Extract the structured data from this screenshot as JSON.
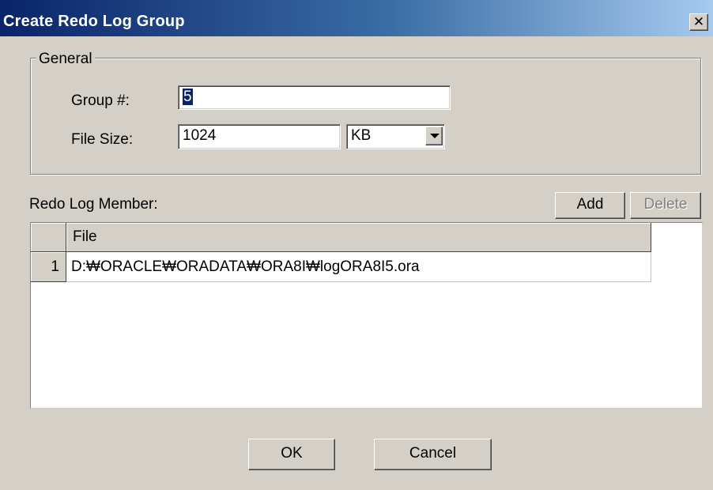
{
  "window": {
    "title": "Create Redo Log Group",
    "close_symbol": "✕"
  },
  "general": {
    "legend": "General",
    "group_label": "Group #:",
    "group_value": "5",
    "filesize_label": "File Size:",
    "filesize_value": "1024",
    "unit_selected": "KB"
  },
  "members": {
    "label": "Redo Log Member:",
    "add_label": "Add",
    "delete_label": "Delete",
    "columns": [
      "File"
    ],
    "rows": [
      {
        "num": "1",
        "file": "D:₩ORACLE₩ORADATA₩ORA8I₩logORA8I5.ora"
      }
    ]
  },
  "footer": {
    "ok_label": "OK",
    "cancel_label": "Cancel"
  },
  "colors": {
    "titlebar_start": "#0a246a",
    "titlebar_end": "#a6caf0",
    "face": "#d4d0c8"
  }
}
